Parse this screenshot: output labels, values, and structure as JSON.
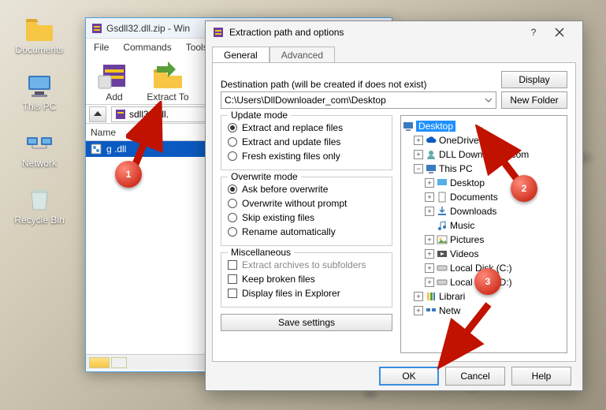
{
  "desktop": {
    "icons": [
      "Documents",
      "This PC",
      "Network",
      "Recycle Bin"
    ]
  },
  "winrar": {
    "title": "Gsdll32.dll.zip - Win",
    "menu": [
      "File",
      "Commands",
      "Tools"
    ],
    "toolbar": [
      "Add",
      "Extract To"
    ],
    "path_file": "sdll32.dll.",
    "column_header": "Name",
    "file_row": "g         .dll"
  },
  "dialog": {
    "title": "Extraction path and options",
    "tabs": [
      "General",
      "Advanced"
    ],
    "dest_label": "Destination path (will be created if does not exist)",
    "dest_value": "C:\\Users\\DllDownloader_com\\Desktop",
    "btn_display": "Display",
    "btn_newfolder": "New Folder",
    "update_mode": {
      "legend": "Update mode",
      "opts": [
        "Extract and replace files",
        "Extract and update files",
        "Fresh existing files only"
      ]
    },
    "overwrite_mode": {
      "legend": "Overwrite mode",
      "opts": [
        "Ask before overwrite",
        "Overwrite without prompt",
        "Skip existing files",
        "Rename automatically"
      ]
    },
    "misc": {
      "legend": "Miscellaneous",
      "opts": [
        "Extract archives to subfolders",
        "Keep broken files",
        "Display files in Explorer"
      ]
    },
    "save_settings": "Save settings",
    "tree_nodes": {
      "desktop": "Desktop",
      "onedrive": "OneDrive",
      "dlldownloader": "DLL Downloader.com",
      "thispc": "This PC",
      "pc_desktop": "Desktop",
      "documents": "Documents",
      "downloads": "Downloads",
      "music": "Music",
      "pictures": "Pictures",
      "videos": "Videos",
      "localc": "Local Disk (C:)",
      "locald": "Local Disk (D:)",
      "libraries": "Librari",
      "network": "Netw"
    },
    "buttons": {
      "ok": "OK",
      "cancel": "Cancel",
      "help": "Help"
    }
  },
  "annotations": {
    "one": "1",
    "two": "2",
    "three": "3"
  }
}
